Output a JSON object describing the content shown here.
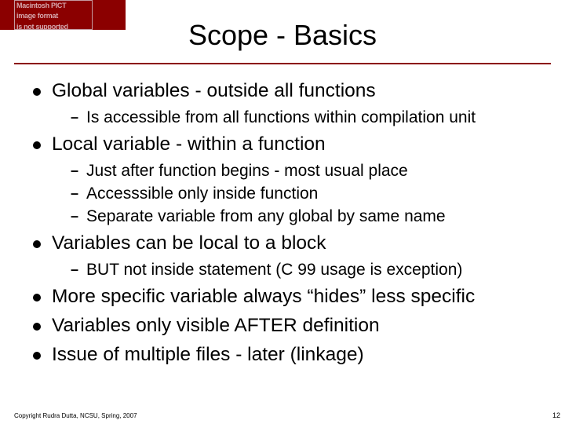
{
  "title": "Scope - Basics",
  "pict_placeholder": {
    "line1": "Macintosh PICT",
    "line2": "image format",
    "line3": "is not supported"
  },
  "bullets": {
    "b1": {
      "text": "Global variables - outside all functions",
      "s1": "Is accessible from all functions within compilation unit"
    },
    "b2": {
      "text": "Local variable - within a function",
      "s1": "Just after function begins - most usual place",
      "s2": "Accesssible only inside function",
      "s3": "Separate variable from any global by same name"
    },
    "b3": {
      "text": "Variables can be local to a block",
      "s1": "BUT not inside statement (C 99 usage is exception)"
    },
    "b4": {
      "text": "More specific variable always “hides” less specific"
    },
    "b5": {
      "text": "Variables only visible AFTER definition"
    },
    "b6": {
      "text": "Issue of multiple files - later (linkage)"
    }
  },
  "footer": "Copyright Rudra Dutta, NCSU, Spring, 2007",
  "page_number": "12"
}
